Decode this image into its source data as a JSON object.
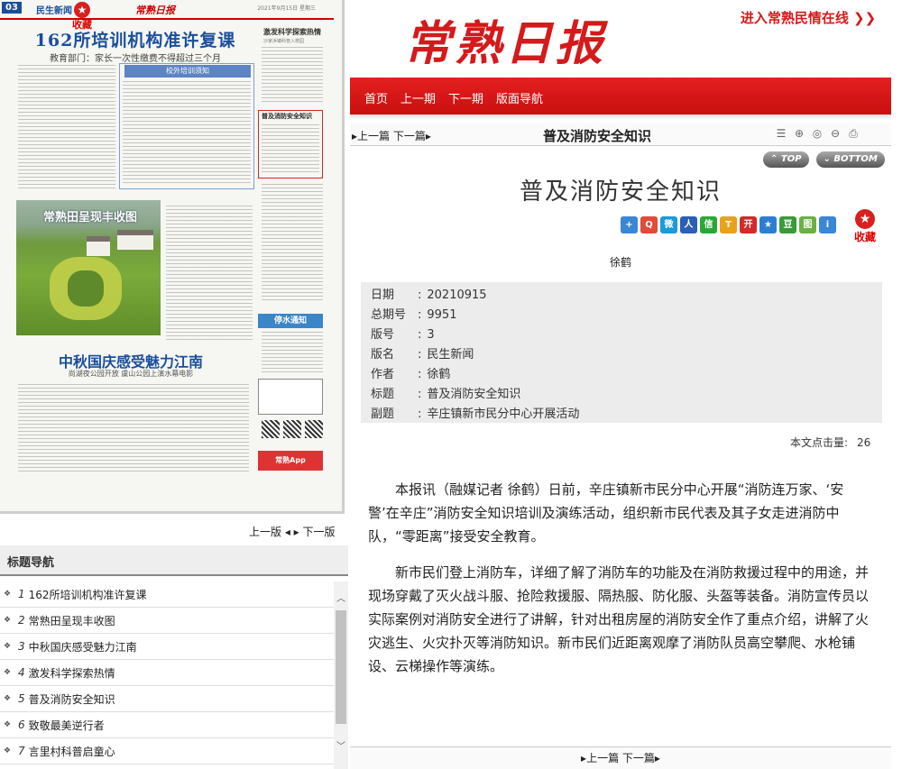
{
  "newspaper_page": {
    "page_number": "03",
    "section": "民生新闻",
    "favorite_label": "收藏",
    "masthead": "常熟日报",
    "date_line": "2021年9月15日 星期三",
    "headline": "162所培训机构准许复课",
    "subhead": "教育部门：家长一次性缴费不得超过三个月",
    "box_title": "校外培训须知",
    "right_story_title": "激发科学探索热情",
    "right_story_sub": "沙家浜镇科普入校园",
    "boxed_story_title": "普及消防安全知识",
    "photo_title": "常熟田呈现丰收图",
    "headline2": "中秋国庆感受魅力江南",
    "subhead2": "尚湖夜公园开放 虞山公园上演水幕电影",
    "water_notice": "停水通知",
    "app_label": "常熟App"
  },
  "left_pager": {
    "prev": "上一版",
    "next": "下一版"
  },
  "title_nav": {
    "heading": "标题导航",
    "items": [
      {
        "num": "1",
        "title": "162所培训机构准许复课"
      },
      {
        "num": "2",
        "title": "常熟田呈现丰收图"
      },
      {
        "num": "3",
        "title": "中秋国庆感受魅力江南"
      },
      {
        "num": "4",
        "title": "激发科学探索热情"
      },
      {
        "num": "5",
        "title": "普及消防安全知识"
      },
      {
        "num": "6",
        "title": "致敬最美逆行者"
      },
      {
        "num": "7",
        "title": "言里村科普启童心"
      }
    ]
  },
  "masthead": {
    "title": "常熟日报",
    "link": "进入常熟民情在线 ❯❯"
  },
  "menu": [
    "首页",
    "上一期",
    "下一期",
    "版面导航"
  ],
  "article_nav": {
    "prev": "上一篇",
    "next": "下一篇",
    "title": "普及消防安全知识"
  },
  "buttons": {
    "top": "TOP",
    "bottom": "BOTTOM"
  },
  "article": {
    "title": "普及消防安全知识",
    "favorite_label": "收藏",
    "author": "徐鹤",
    "meta": [
      {
        "key": "日期",
        "value": "20210915"
      },
      {
        "key": "总期号",
        "value": "9951"
      },
      {
        "key": "版号",
        "value": "3"
      },
      {
        "key": "版名",
        "value": "民生新闻"
      },
      {
        "key": "作者",
        "value": "徐鹤"
      },
      {
        "key": "标题",
        "value": "普及消防安全知识"
      },
      {
        "key": "副题",
        "value": "辛庄镇新市民分中心开展活动"
      }
    ],
    "hits_label": "本文点击量:",
    "hits_value": "26",
    "paragraphs": [
      "本报讯（融媒记者 徐鹤）日前，辛庄镇新市民分中心开展“消防连万家、‘安警’在辛庄”消防安全知识培训及演练活动，组织新市民代表及其子女走进消防中队，“零距离”接受安全教育。",
      "新市民们登上消防车，详细了解了消防车的功能及在消防救援过程中的用途，并现场穿戴了灭火战斗服、抢险救援服、隔热服、防化服、头盔等装备。消防宣传员以实际案例对消防安全进行了讲解，针对出租房屋的消防安全作了重点介绍，讲解了火灾逃生、火灾扑灭等消防知识。新市民们近距离观摩了消防队员高空攀爬、水枪铺设、云梯操作等演练。"
    ]
  },
  "footer_nav": {
    "prev": "上一篇",
    "next": "下一篇"
  },
  "share_icons": [
    {
      "name": "share-more-icon",
      "glyph": "+",
      "color": "#3a87d6"
    },
    {
      "name": "share-qzone-icon",
      "glyph": "Q",
      "color": "#e24a3a"
    },
    {
      "name": "share-weibo-icon",
      "glyph": "微",
      "color": "#1d9ad8"
    },
    {
      "name": "share-renren-icon",
      "glyph": "人",
      "color": "#2b5fb5"
    },
    {
      "name": "share-wechat-icon",
      "glyph": "信",
      "color": "#2aa836"
    },
    {
      "name": "share-tqq-icon",
      "glyph": "T",
      "color": "#e8a21c"
    },
    {
      "name": "share-kaixin-icon",
      "glyph": "开",
      "color": "#d42a2a"
    },
    {
      "name": "share-star-icon",
      "glyph": "★",
      "color": "#2c7fd0"
    },
    {
      "name": "share-douban-icon",
      "glyph": "豆",
      "color": "#3a9a3a"
    },
    {
      "name": "share-image-icon",
      "glyph": "图",
      "color": "#6bb043"
    },
    {
      "name": "share-info-icon",
      "glyph": "i",
      "color": "#3a87d6"
    }
  ]
}
